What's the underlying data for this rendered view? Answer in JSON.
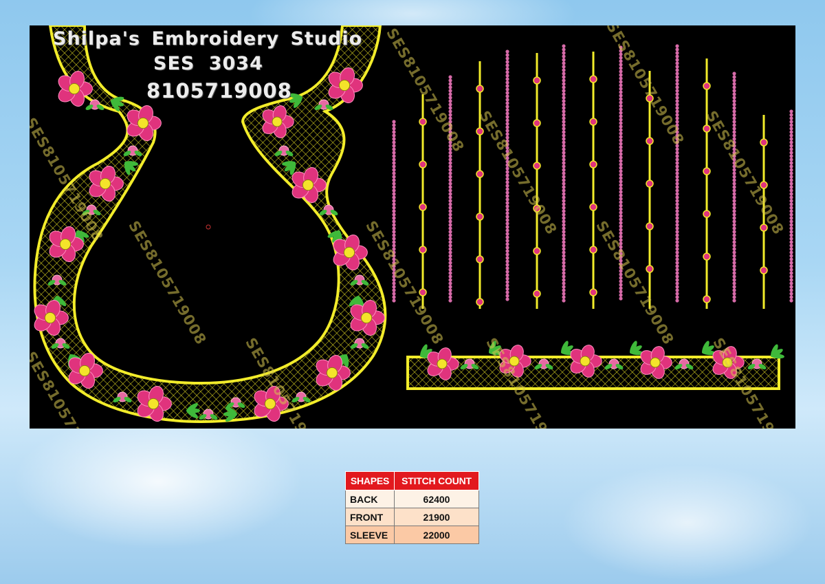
{
  "header": {
    "studio_name": "Shilpa's Embroidery Studio",
    "design_code": "SES 3034",
    "phone": "8105719008"
  },
  "watermark": "SES8105719008",
  "colors": {
    "canvas": "#000000",
    "outline": "#f2ec2a",
    "flower": "#e0337d",
    "bead": "#d66aa8",
    "leaf": "#3fb93a",
    "table_header": "#e2191e"
  },
  "table": {
    "headers": [
      "SHAPES",
      "STITCH COUNT"
    ],
    "rows": [
      {
        "shape": "BACK",
        "count": "62400"
      },
      {
        "shape": "FRONT",
        "count": "21900"
      },
      {
        "shape": "SLEEVE",
        "count": "22000"
      }
    ]
  }
}
